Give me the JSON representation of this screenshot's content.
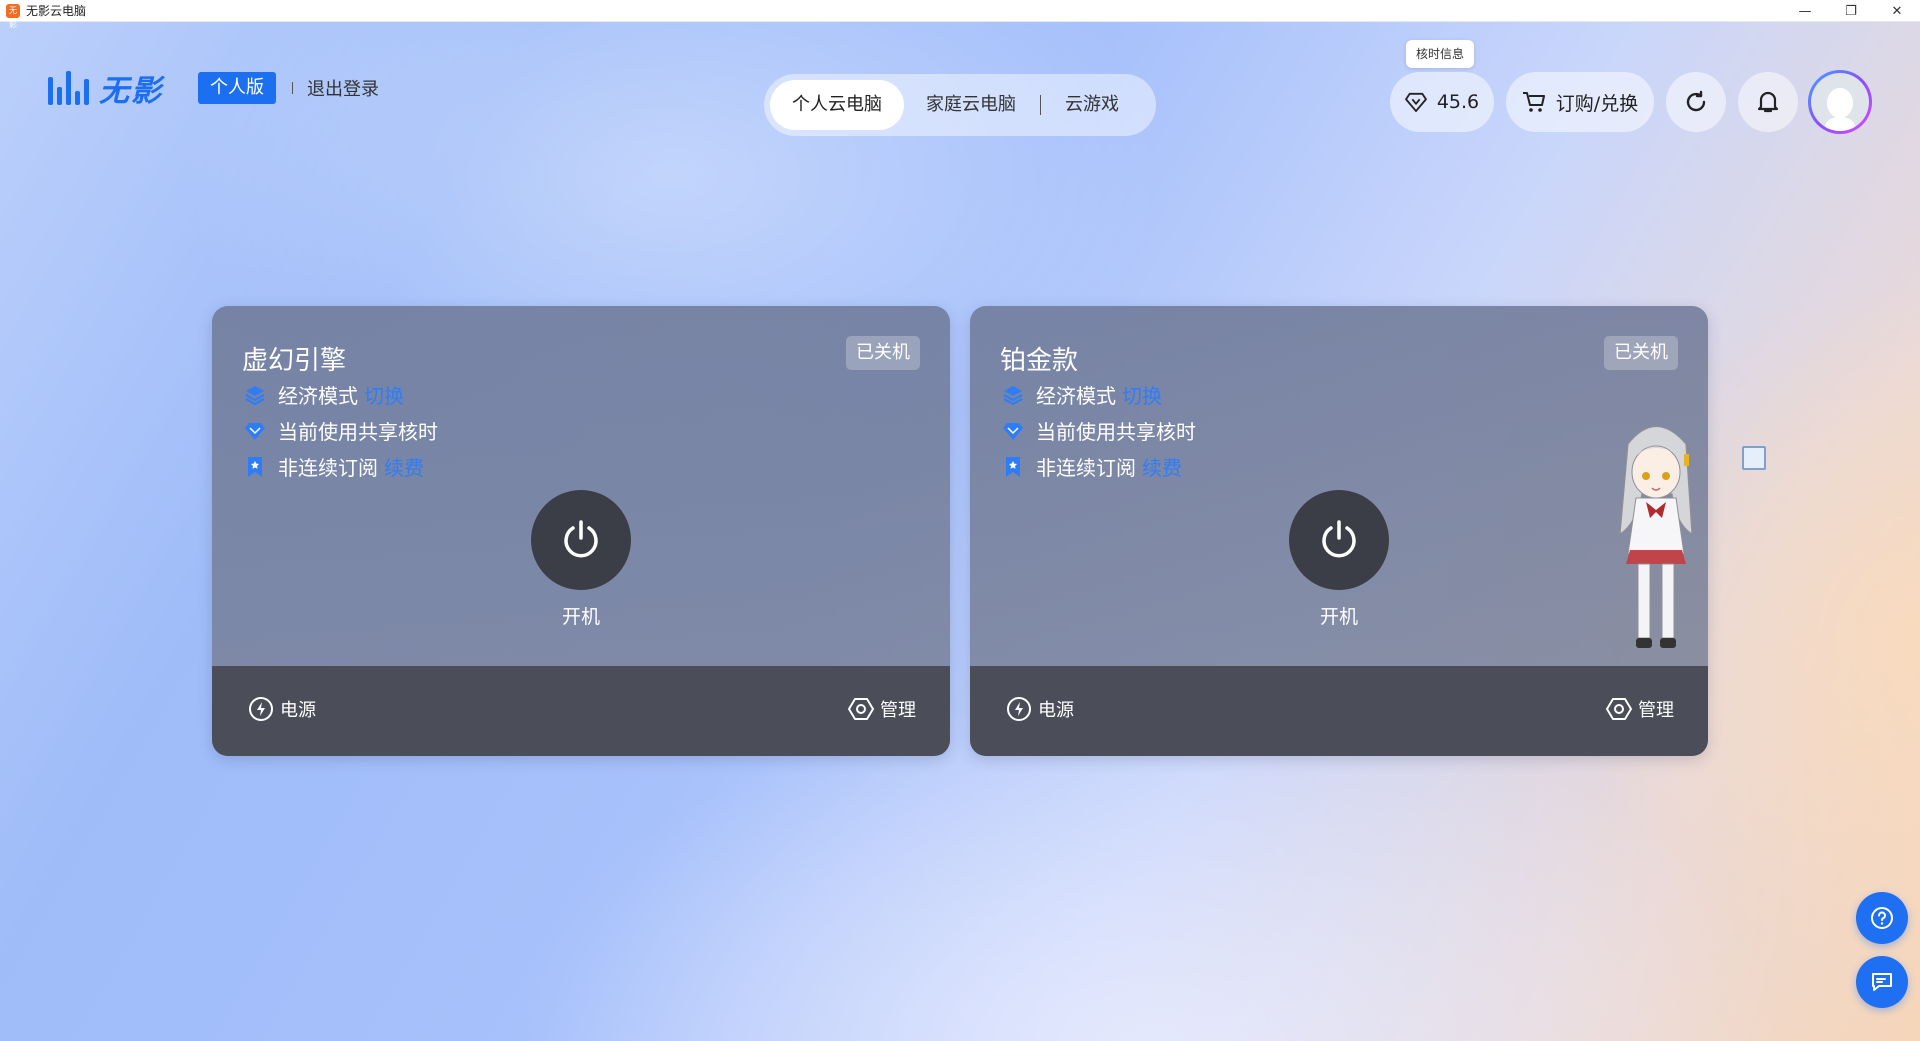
{
  "window": {
    "title": "无影云电脑",
    "app_icon_text": "无影",
    "minimize": "—",
    "restore": "❐",
    "close": "✕"
  },
  "header": {
    "logo_text": "无影",
    "edition": "个人版",
    "logout": "退出登录",
    "tabs": [
      {
        "label": "个人云电脑",
        "active": true
      },
      {
        "label": "家庭云电脑",
        "active": false
      },
      {
        "label": "云游戏",
        "active": false
      }
    ],
    "tooltip": "核时信息",
    "core_hours": "45.6",
    "subscribe_label": "订购/兑换"
  },
  "cards": [
    {
      "title": "虚幻引擎",
      "status": "已关机",
      "mode_text": "经济模式",
      "mode_link": "切换",
      "share_text": "当前使用共享核时",
      "sub_text": "非连续订阅",
      "sub_link": "续费",
      "power_label": "开机",
      "footer_power": "电源",
      "footer_manage": "管理"
    },
    {
      "title": "铂金款",
      "status": "已关机",
      "mode_text": "经济模式",
      "mode_link": "切换",
      "share_text": "当前使用共享核时",
      "sub_text": "非连续订阅",
      "sub_link": "续费",
      "power_label": "开机",
      "footer_power": "电源",
      "footer_manage": "管理"
    }
  ],
  "colors": {
    "brand": "#1d6ff2",
    "link": "#2f7df6",
    "card_footer": "#4b4e58",
    "power_button": "#3b3e47"
  },
  "icons": {
    "diamond": "diamond-icon",
    "cart": "cart-icon",
    "refresh": "refresh-icon",
    "bell": "bell-icon",
    "layers": "layers-icon",
    "power": "power-icon",
    "bookmark": "bookmark-icon",
    "lightning": "lightning-icon",
    "settings": "hexagon-settings-icon",
    "help": "help-icon",
    "feedback": "feedback-icon"
  }
}
